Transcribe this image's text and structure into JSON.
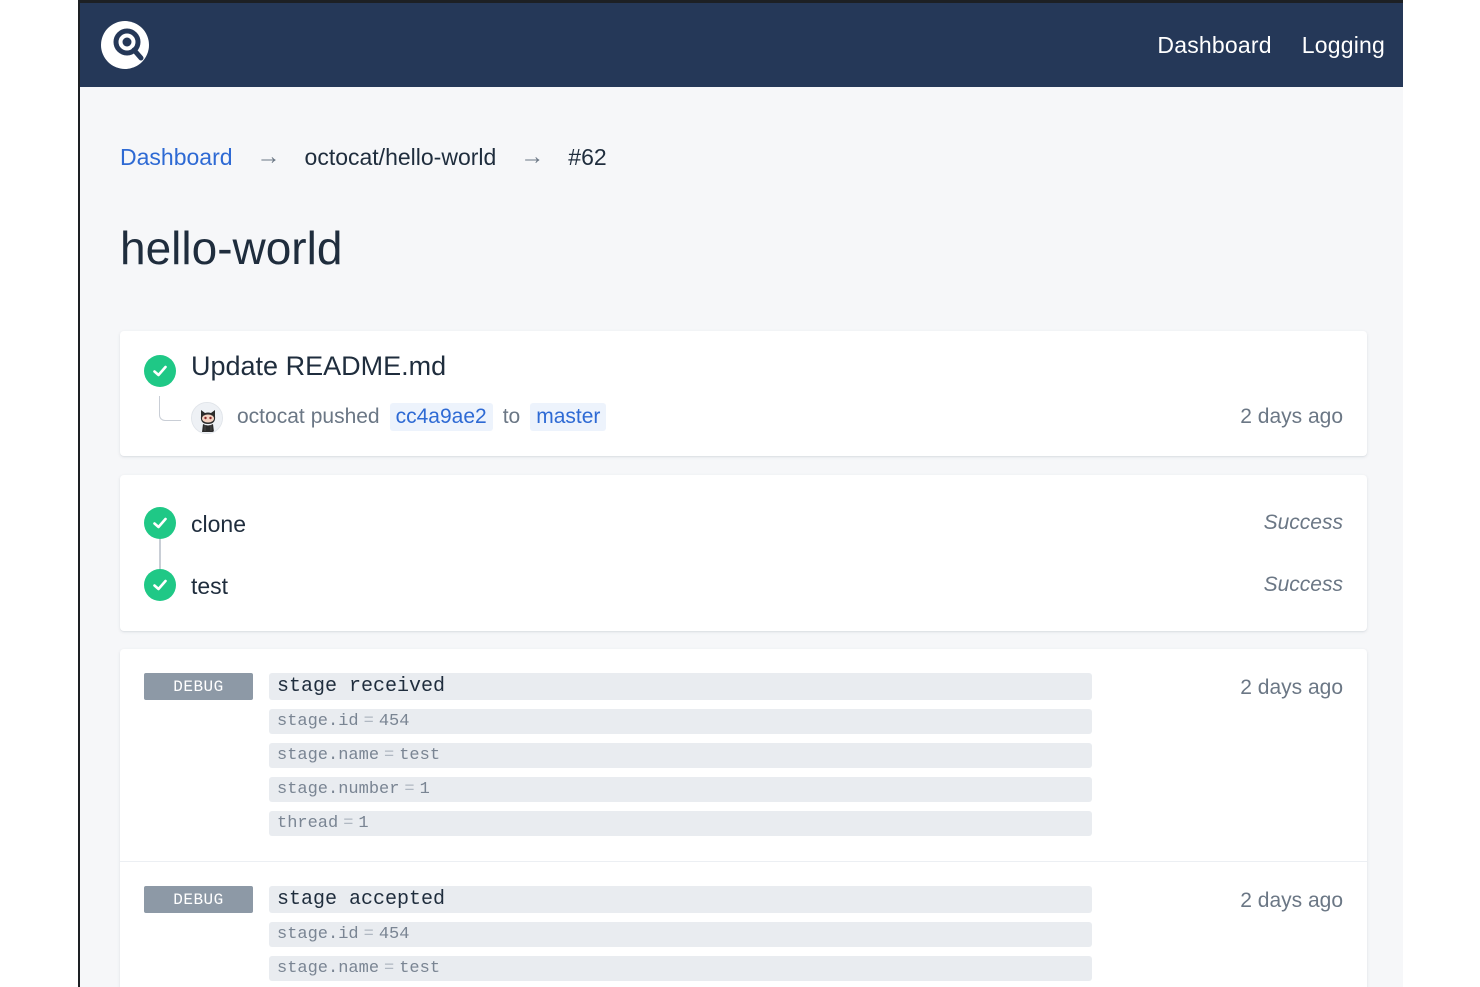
{
  "header": {
    "nav": [
      {
        "label": "Dashboard"
      },
      {
        "label": "Logging"
      }
    ]
  },
  "breadcrumb": {
    "items": [
      "Dashboard",
      "octocat/hello-world",
      "#62"
    ],
    "separator": "→"
  },
  "page": {
    "title": "hello-world"
  },
  "commit": {
    "message": "Update README.md",
    "author": "octocat",
    "action": "pushed",
    "sha": "cc4a9ae2",
    "connector": "to",
    "branch": "master",
    "time": "2 days ago",
    "status_icon": "check-circle-icon"
  },
  "steps": [
    {
      "name": "clone",
      "status": "Success"
    },
    {
      "name": "test",
      "status": "Success"
    }
  ],
  "logs": [
    {
      "level": "DEBUG",
      "message": "stage received",
      "time": "2 days ago",
      "fields": [
        {
          "key": "stage.id",
          "value": "454"
        },
        {
          "key": "stage.name",
          "value": "test"
        },
        {
          "key": "stage.number",
          "value": "1"
        },
        {
          "key": "thread",
          "value": "1"
        }
      ]
    },
    {
      "level": "DEBUG",
      "message": "stage accepted",
      "time": "2 days ago",
      "fields": [
        {
          "key": "stage.id",
          "value": "454"
        },
        {
          "key": "stage.name",
          "value": "test"
        }
      ]
    }
  ],
  "colors": {
    "header_bg": "#253858",
    "page_bg": "#f6f7f9",
    "link": "#2e6ad4",
    "success": "#1fc886",
    "badge": "#8d99a6"
  }
}
